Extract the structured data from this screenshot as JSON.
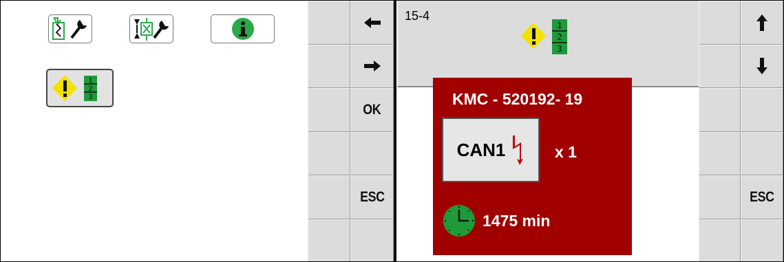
{
  "left_pane": {
    "tools": [
      {
        "name": "machine-setup-tool"
      },
      {
        "name": "valve-setup-tool"
      },
      {
        "name": "info"
      },
      {
        "name": "alarm-list",
        "selected": true
      }
    ]
  },
  "softkeys_left": [
    {
      "label": "",
      "icon": "arrow-left-icon"
    },
    {
      "label": "",
      "icon": "arrow-right-icon"
    },
    {
      "label": "OK"
    },
    {
      "label": ""
    },
    {
      "label": "ESC"
    },
    {
      "label": ""
    }
  ],
  "softkeys_right": [
    {
      "label": "",
      "icon": "arrow-up-icon"
    },
    {
      "label": "",
      "icon": "arrow-down-icon"
    },
    {
      "label": ""
    },
    {
      "label": ""
    },
    {
      "label": "ESC"
    },
    {
      "label": ""
    }
  ],
  "header": {
    "number": "15-4",
    "icon": "alarm-list-icon",
    "alarm_list_numbers": [
      "1",
      "2",
      "3"
    ]
  },
  "alarm": {
    "code": "KMC - 520192- 19",
    "bus_label": "CAN1",
    "bus_icon": "lightning-icon",
    "count": "x 1",
    "duration_icon": "clock-icon",
    "duration": "1475 min"
  },
  "colors": {
    "alarm_bg": "#a00000",
    "softkey_bg": "#dcdcdc",
    "warning_yellow": "#f3e100",
    "list_green": "#1f9a3a",
    "tool_green": "#2aa84a",
    "lightning_red": "#c00000"
  }
}
